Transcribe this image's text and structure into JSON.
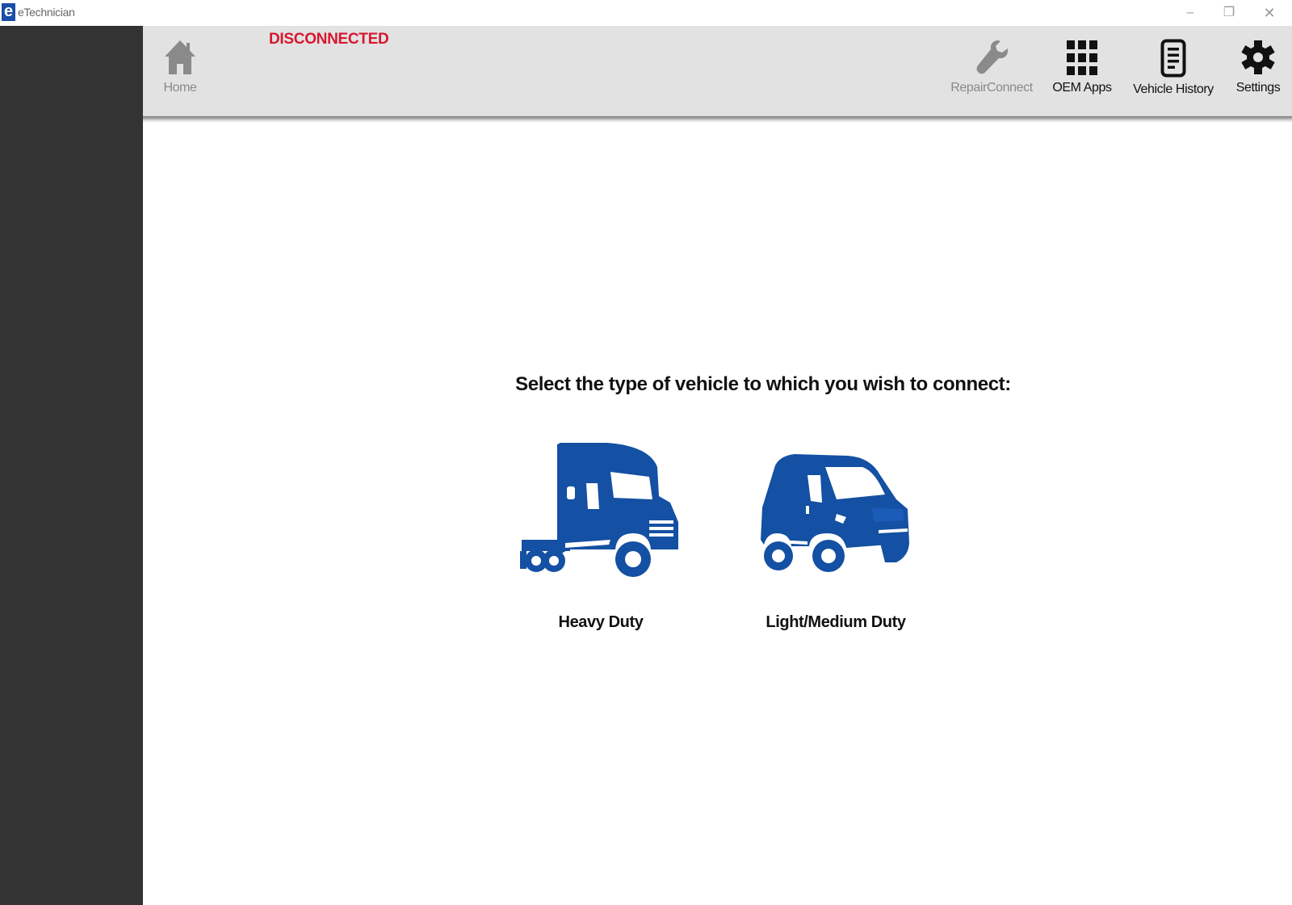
{
  "window": {
    "title": "eTechnician",
    "logo_letter": "e",
    "controls": {
      "minimize": "–",
      "maximize": "❐",
      "close": "✕"
    }
  },
  "toolbar": {
    "status": "DISCONNECTED",
    "status_color": "#d7172f",
    "home_label": "Home",
    "items": [
      {
        "label": "RepairConnect",
        "icon": "wrench-icon",
        "enabled": false
      },
      {
        "label": "OEM Apps",
        "icon": "grid-icon",
        "enabled": true
      },
      {
        "label": "Vehicle History",
        "icon": "document-icon",
        "enabled": true
      },
      {
        "label": "Settings",
        "icon": "gear-icon",
        "enabled": true
      }
    ]
  },
  "main": {
    "prompt": "Select the type of vehicle to which you wish to connect:",
    "vehicles": [
      {
        "label": "Heavy Duty",
        "icon": "semi-truck-icon"
      },
      {
        "label": "Light/Medium Duty",
        "icon": "van-icon"
      }
    ],
    "accent_color": "#1450a3"
  }
}
